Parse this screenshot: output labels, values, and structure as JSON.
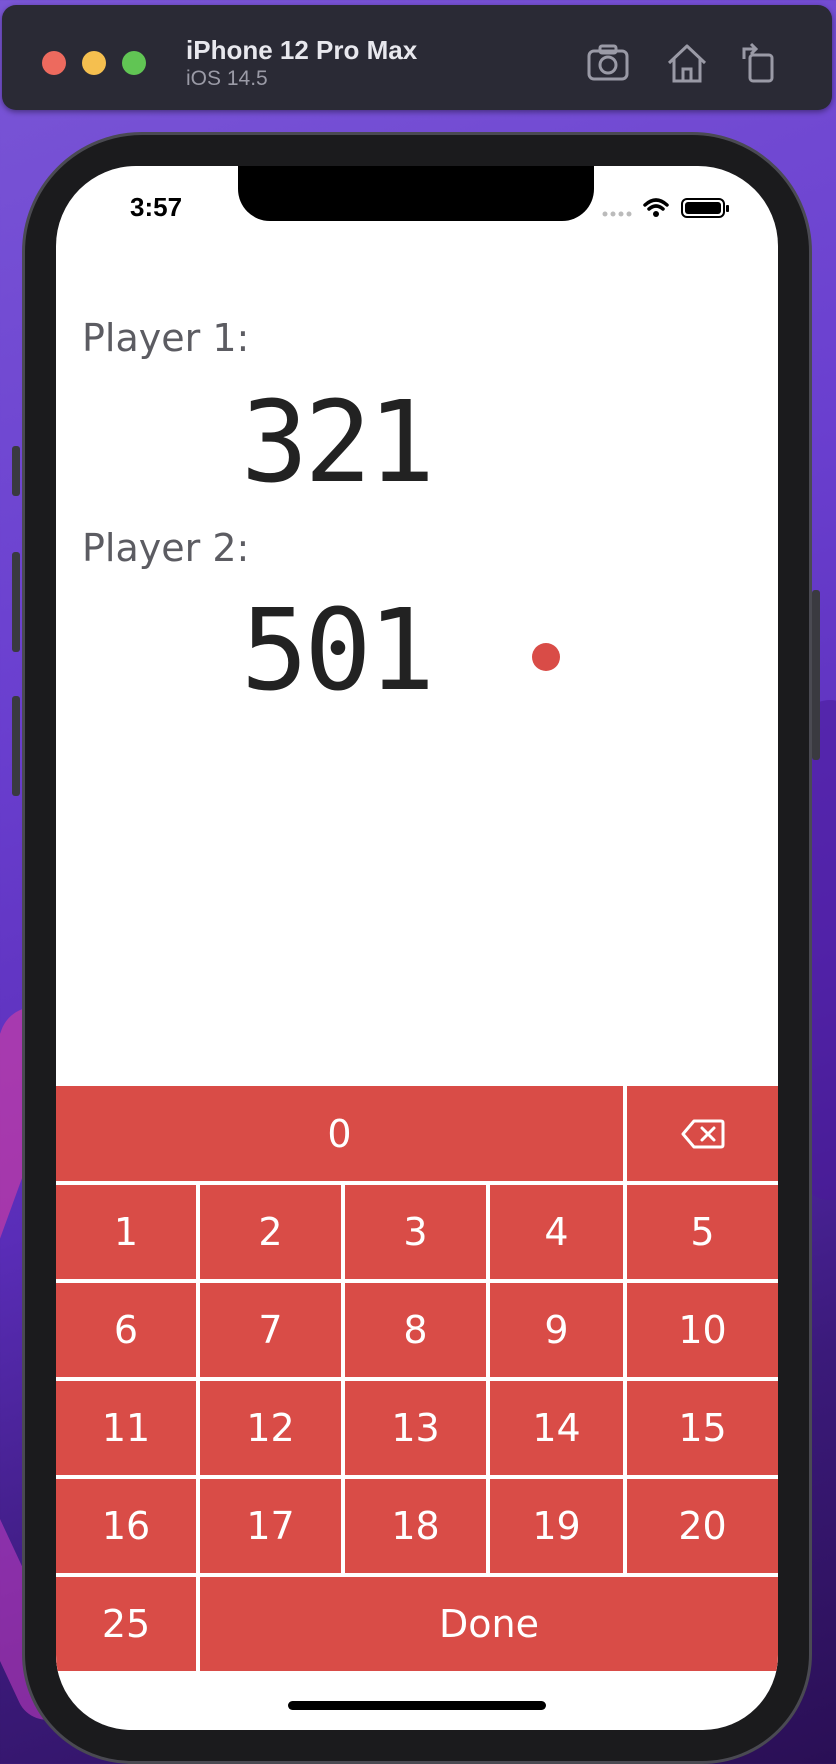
{
  "simulator": {
    "device_name": "iPhone 12 Pro Max",
    "os_version": "iOS 14.5",
    "icons": [
      "screenshot-icon",
      "home-icon",
      "rotate-icon"
    ]
  },
  "status_bar": {
    "time": "3:57",
    "icons": [
      "signal-icon",
      "wifi-icon",
      "battery-icon"
    ]
  },
  "players": [
    {
      "label": "Player 1:",
      "score": "321",
      "active": false
    },
    {
      "label": "Player 2:",
      "score": "501",
      "active": true
    }
  ],
  "keypad": {
    "zero_label": "0",
    "backspace_icon": "backspace-icon",
    "number_keys": [
      "1",
      "2",
      "3",
      "4",
      "5",
      "6",
      "7",
      "8",
      "9",
      "10",
      "11",
      "12",
      "13",
      "14",
      "15",
      "16",
      "17",
      "18",
      "19",
      "20"
    ],
    "bull_key": "25",
    "done_label": "Done"
  },
  "colors": {
    "accent": "#d94c47",
    "score_text": "#222222",
    "label_text": "#5c5c62"
  }
}
